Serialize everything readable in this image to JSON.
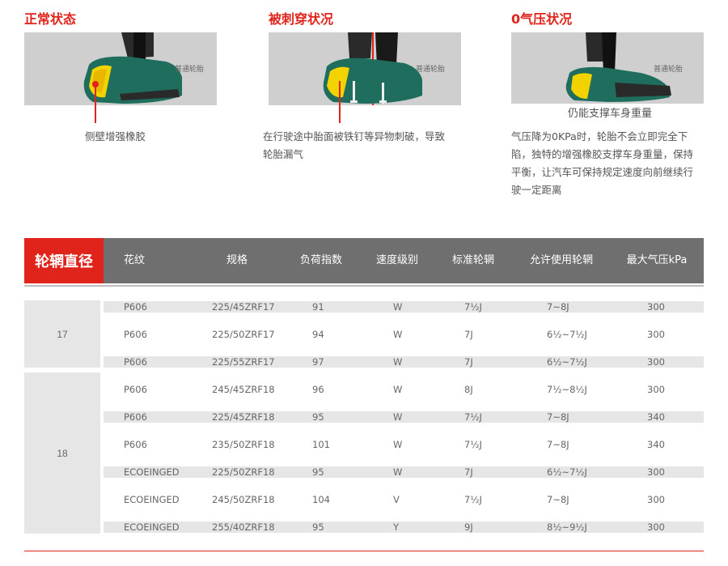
{
  "panels": [
    {
      "title": "正常状态",
      "tire_label": "普通轮胎",
      "caption": "侧壁增强橡胶"
    },
    {
      "title": "被刺穿状况",
      "tire_label": "普通轮胎",
      "caption": "在行驶途中胎面被铁钉等异物刺破，导致轮胎漏气"
    },
    {
      "title": "0气压状况",
      "tire_label": "普通轮胎",
      "subcaption": "仍能支撑车身重量",
      "caption": "气压降为0KPa时，轮胎不会立即完全下陷，独特的增强橡胶支撑车身重量，保持平衡，让汽车可保持规定速度向前继续行驶一定距离"
    }
  ],
  "colors": {
    "accent": "#e0241b",
    "header_bg": "#6f6f6f",
    "row_shade": "#e6e6e6",
    "tire_green": "#1f6e5d",
    "tire_yellow": "#f2d300"
  },
  "table": {
    "headers": [
      "轮辋直径",
      "花纹",
      "规格",
      "负荷指数",
      "速度级别",
      "标准轮辋",
      "允许使用轮辋",
      "最大气压kPa"
    ],
    "groups": [
      {
        "rim": "17",
        "rows": [
          [
            "P606",
            "225/45ZRF17",
            "91",
            "W",
            "7½J",
            "7~8J",
            "300"
          ],
          [
            "P606",
            "225/50ZRF17",
            "94",
            "W",
            "7J",
            "6½~7½J",
            "300"
          ],
          [
            "P606",
            "225/55ZRF17",
            "97",
            "W",
            "7J",
            "6½~7½J",
            "300"
          ]
        ]
      },
      {
        "rim": "18",
        "rows": [
          [
            "P606",
            "245/45ZRF18",
            "96",
            "W",
            "8J",
            "7½~8½J",
            "300"
          ],
          [
            "P606",
            "225/45ZRF18",
            "95",
            "W",
            "7½J",
            "7~8J",
            "340"
          ],
          [
            "P606",
            "235/50ZRF18",
            "101",
            "W",
            "7½J",
            "7~8J",
            "340"
          ],
          [
            "ECOEINGED",
            "225/50ZRF18",
            "95",
            "W",
            "7J",
            "6½~7½J",
            "300"
          ],
          [
            "ECOEINGED",
            "245/50ZRF18",
            "104",
            "V",
            "7½J",
            "7~8J",
            "300"
          ],
          [
            "ECOEINGED",
            "255/40ZRF18",
            "95",
            "Y",
            "9J",
            "8½~9½J",
            "300"
          ]
        ]
      }
    ]
  }
}
